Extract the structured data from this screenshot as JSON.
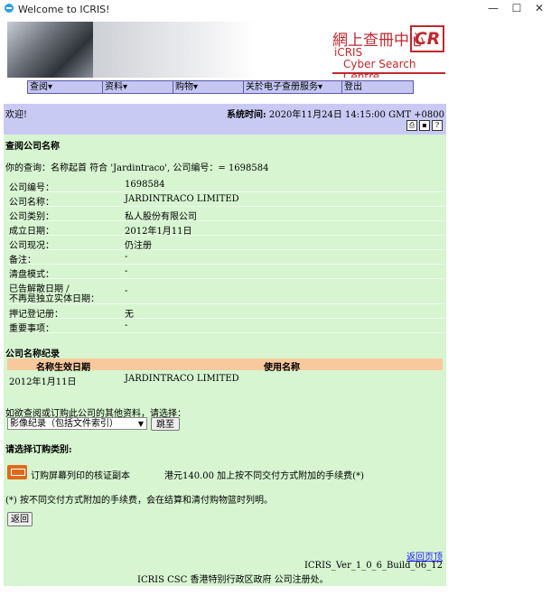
{
  "window": {
    "title": "Welcome to ICRIS!",
    "minimize": "—",
    "maximize": "☐",
    "close": "✕"
  },
  "banner": {
    "brand_cn": "網上查冊中心",
    "brand_logo": "CR",
    "icris": "iCRIS",
    "csc": "Cyber Search Centre"
  },
  "menu": [
    {
      "label": "查阅▾"
    },
    {
      "label": "资料▾"
    },
    {
      "label": "购物▾"
    },
    {
      "label": "关於电子查册服务▾"
    },
    {
      "label": "登出"
    }
  ],
  "info": {
    "welcome": "欢迎!",
    "systime_label": "系统时间:",
    "systime_value": "2020年11月24日 14:15:00 GMT +0800",
    "icons": [
      "print-icon",
      "save-icon",
      "help-icon"
    ]
  },
  "query": {
    "section_title": "查阅公司名称",
    "query_text": "你的查询：名称起首 符合 'Jardintraco', 公司编号：= 1698584"
  },
  "fields": [
    {
      "label": "公司编号：",
      "value": "1698584"
    },
    {
      "label": "公司名称：",
      "value": "JARDINTRACO LIMITED"
    },
    {
      "label": "公司类别：",
      "value": "私人股份有限公司"
    },
    {
      "label": "成立日期：",
      "value": "2012年1月11日"
    },
    {
      "label": "公司现况：",
      "value": "仍注册"
    },
    {
      "label": "备注：",
      "value": "-"
    },
    {
      "label": "清盘模式：",
      "value": "-"
    },
    {
      "label": "已告解散日期 /",
      "label2": "不再是独立实体日期：",
      "value": "-"
    },
    {
      "label": "押记登记册：",
      "value": "无"
    },
    {
      "label": "重要事项：",
      "value": "-"
    }
  ],
  "history": {
    "title": "公司名称纪录",
    "col_date": "名称生效日期",
    "col_name": "使用名称",
    "rows": [
      {
        "date": "2012年1月11日",
        "name": "JARDINTRACO LIMITED"
      }
    ]
  },
  "more": {
    "prompt": "如欲查阅或订购此公司的其他资料，请选择：",
    "select_value": "影像纪录（包括文件索引）",
    "go_button": "跳至"
  },
  "order": {
    "title": "请选择订购类别:",
    "item_label": "订购屏幕列印的核证副本",
    "item_price": "港元140.00 加上按不同交付方式附加的手续费(*)",
    "note": "(*) 按不同交付方式附加的手续费，会在结算和清付购物篮时列明。",
    "back_button": "返回"
  },
  "footer": {
    "back_link": "返回页顶",
    "version": "ICRIS_Ver_1_0_6_Build_06_12",
    "copyright": "ICRIS CSC 香港特别行政区政府 公司注册处。"
  }
}
